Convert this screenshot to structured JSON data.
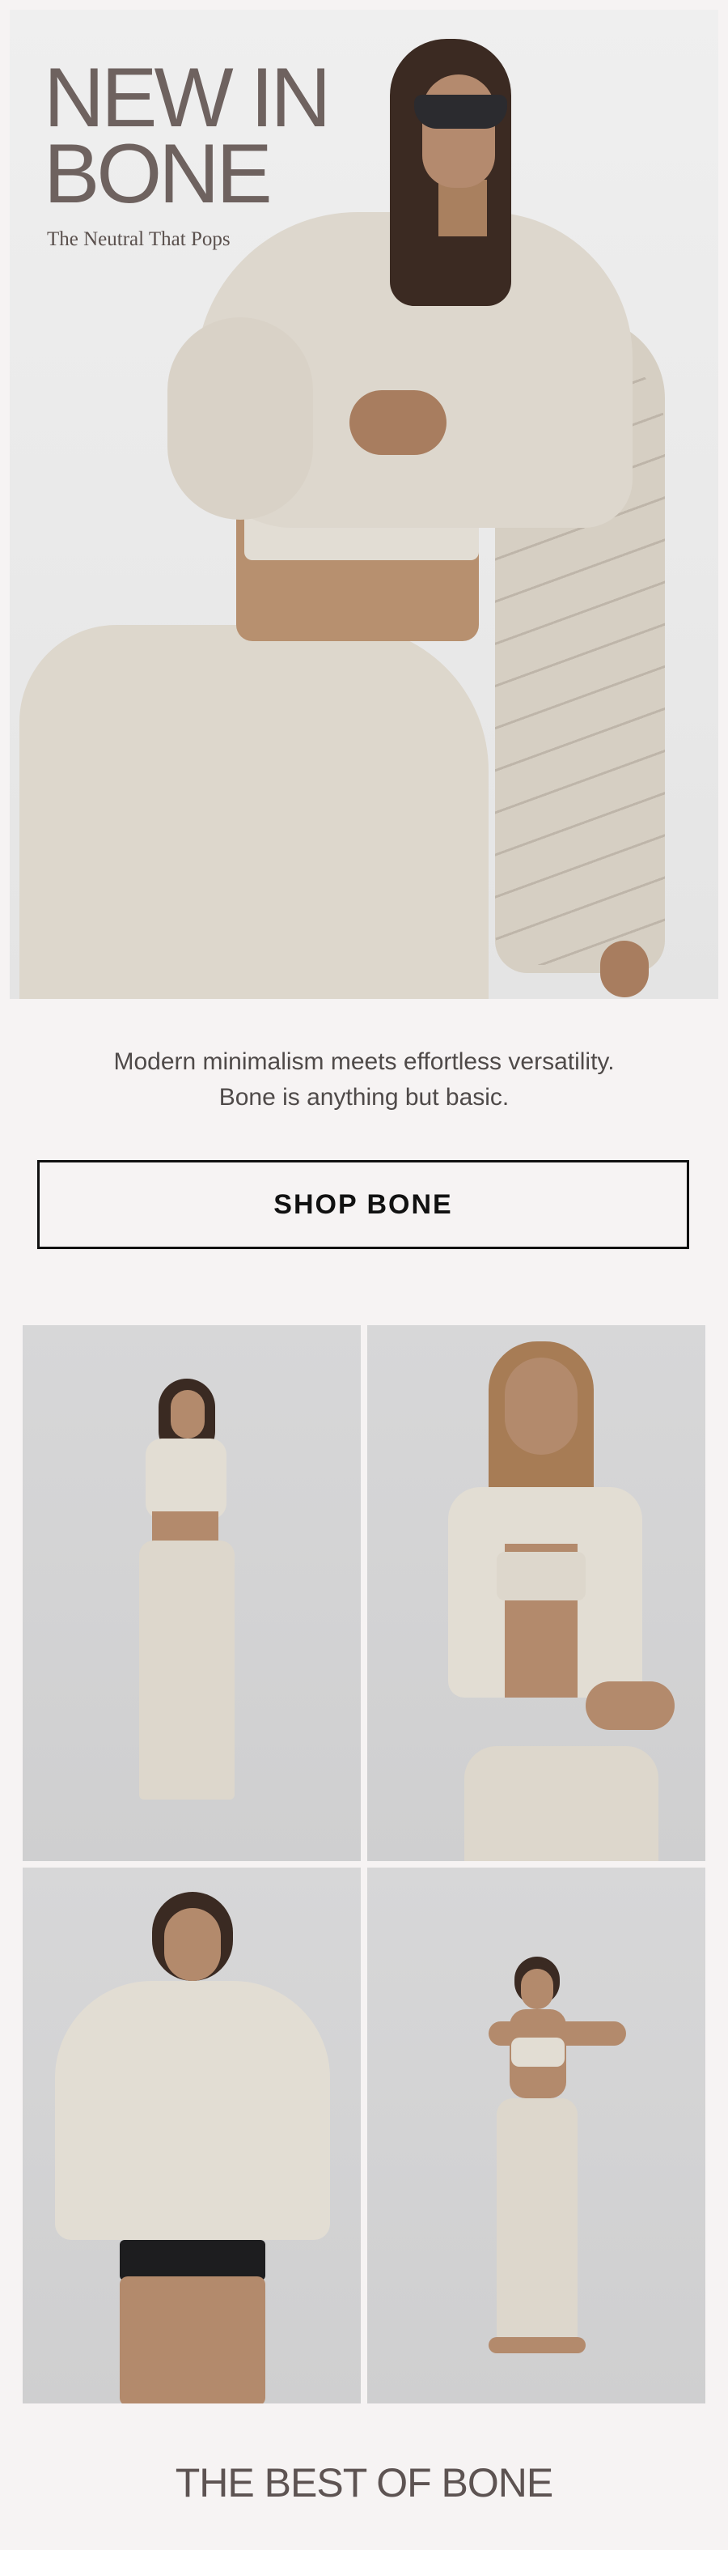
{
  "hero": {
    "title_line1": "NEW IN",
    "title_line2": "BONE",
    "subtitle": "The Neutral That Pops"
  },
  "intro": {
    "line1": "Modern minimalism meets effortless versatility.",
    "line2": "Bone is anything but basic."
  },
  "cta": {
    "label": "SHOP BONE"
  },
  "footer": {
    "title": "THE BEST OF BONE"
  },
  "colors": {
    "background": "#f6f3f3",
    "title": "#6e625f",
    "button_border": "#111111",
    "bone": "#e2ddd3"
  }
}
